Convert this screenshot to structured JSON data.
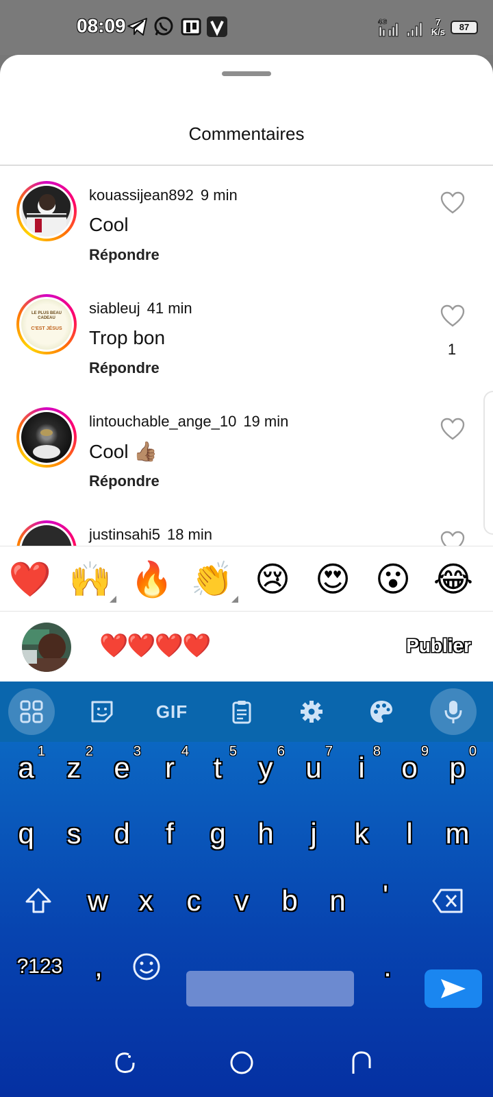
{
  "status_bar": {
    "time": "08:09",
    "network": "4G",
    "speed_value": "7",
    "speed_unit": "K/s",
    "battery": "87"
  },
  "sheet": {
    "title": "Commentaires"
  },
  "comments": [
    {
      "username": "kouassijean892",
      "time": "9 min",
      "text": "Cool",
      "reply_label": "Répondre",
      "likes": ""
    },
    {
      "username": "siableuj",
      "time": "41 min",
      "text": "Trop bon",
      "reply_label": "Répondre",
      "likes": "1"
    },
    {
      "username": "lintouchable_ange_10",
      "time": "19 min",
      "text": "Cool 👍🏽",
      "reply_label": "Répondre",
      "likes": ""
    },
    {
      "username": "justinsahi5",
      "time": "18 min",
      "text": "",
      "reply_label": "",
      "likes": ""
    }
  ],
  "avatar_2_caption": {
    "line1": "LE PLUS BEAU CADEAU",
    "line2": "C'EST JÉSUS"
  },
  "emoji_bar": [
    "❤️",
    "🙌",
    "🔥",
    "👏",
    "😢",
    "😍",
    "😮",
    "😂"
  ],
  "composer": {
    "input_value": "❤️❤️❤️❤️",
    "publish_label": "Publier"
  },
  "keyboard": {
    "toolbar": [
      "apps-grid-icon",
      "sticker-icon",
      "GIF",
      "clipboard-icon",
      "settings-gear-icon",
      "palette-icon",
      "microphone-icon"
    ],
    "gif_label": "GIF",
    "row1": [
      {
        "key": "a",
        "hint": "1"
      },
      {
        "key": "z",
        "hint": "2"
      },
      {
        "key": "e",
        "hint": "3"
      },
      {
        "key": "r",
        "hint": "4"
      },
      {
        "key": "t",
        "hint": "5"
      },
      {
        "key": "y",
        "hint": "6"
      },
      {
        "key": "u",
        "hint": "7"
      },
      {
        "key": "i",
        "hint": "8"
      },
      {
        "key": "o",
        "hint": "9"
      },
      {
        "key": "p",
        "hint": "0"
      }
    ],
    "row2": [
      "q",
      "s",
      "d",
      "f",
      "g",
      "h",
      "j",
      "k",
      "l",
      "m"
    ],
    "row3": [
      "w",
      "x",
      "c",
      "v",
      "b",
      "n",
      "'"
    ],
    "symbols_key": "?123",
    "comma_key": ",",
    "period_key": ".",
    "colors": {
      "accent": "#1a86f0",
      "keyboard_top": "#0a74c6",
      "keyboard_bottom": "#0530a2"
    }
  },
  "colors": {
    "like_heart_outline": "#9a9a9a",
    "story_ring": "#ff0069",
    "heart_red": "#d01a1a"
  }
}
